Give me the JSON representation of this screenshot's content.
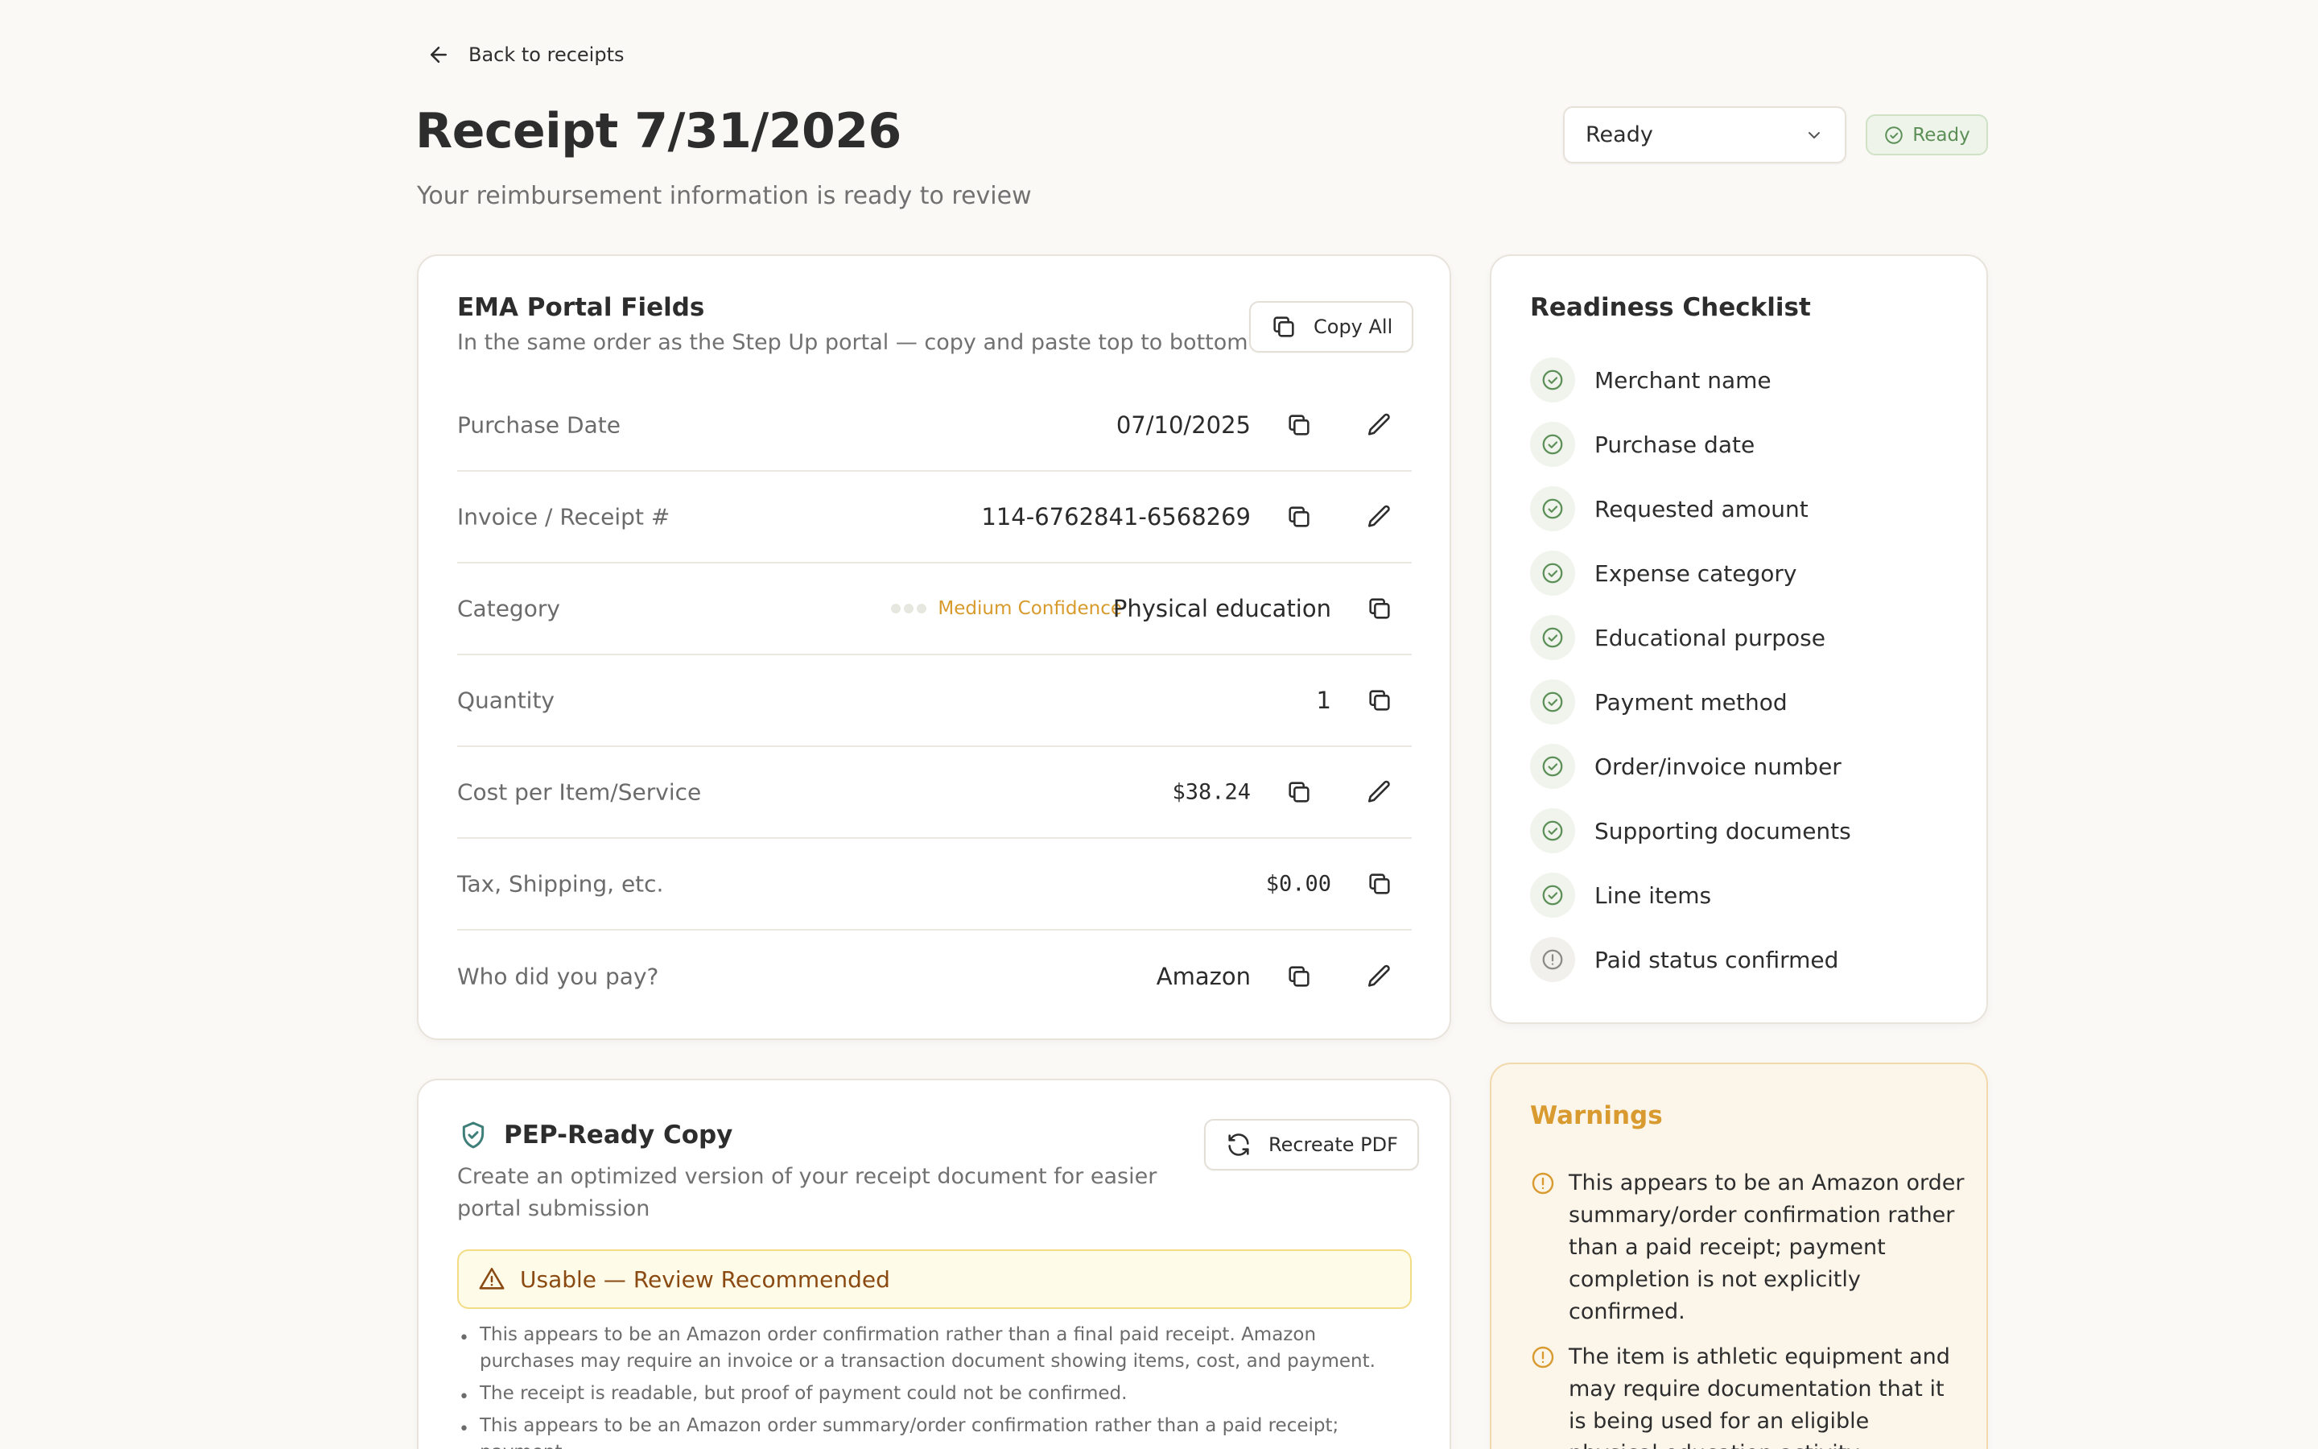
{
  "header": {
    "back_label": "Back to receipts",
    "title": "Receipt 7/31/2026",
    "subtitle": "Your reimbursement information is ready to review",
    "status_select_value": "Ready",
    "status_badge": "Ready"
  },
  "colors": {
    "accent_green": "#5c8f58",
    "warning_amber": "#d99a30",
    "background": "#faf9f6"
  },
  "fields_card": {
    "title": "EMA Portal Fields",
    "subtitle": "In the same order as the Step Up portal — copy and paste top to bottom",
    "copy_all_label": "Copy All",
    "rows": [
      {
        "label": "Purchase Date",
        "value": "07/10/2025",
        "editable": true
      },
      {
        "label": "Invoice / Receipt #",
        "value": "114-6762841-6568269",
        "editable": true
      },
      {
        "label": "Category",
        "value": "Physical education",
        "confidence": "Medium Confidence",
        "editable": false
      },
      {
        "label": "Quantity",
        "value": "1",
        "editable": false
      },
      {
        "label": "Cost per Item/Service",
        "value": "$38.24",
        "editable": true
      },
      {
        "label": "Tax, Shipping, etc.",
        "value": "$0.00",
        "editable": false
      },
      {
        "label": "Who did you pay?",
        "value": "Amazon",
        "editable": true
      }
    ]
  },
  "checklist": {
    "title": "Readiness Checklist",
    "items": [
      {
        "label": "Merchant name",
        "status": "complete"
      },
      {
        "label": "Purchase date",
        "status": "complete"
      },
      {
        "label": "Requested amount",
        "status": "complete"
      },
      {
        "label": "Expense category",
        "status": "complete"
      },
      {
        "label": "Educational purpose",
        "status": "complete"
      },
      {
        "label": "Payment method",
        "status": "complete"
      },
      {
        "label": "Order/invoice number",
        "status": "complete"
      },
      {
        "label": "Supporting documents",
        "status": "complete"
      },
      {
        "label": "Line items",
        "status": "complete"
      },
      {
        "label": "Paid status confirmed",
        "status": "pending"
      }
    ]
  },
  "pep": {
    "title": "PEP-Ready Copy",
    "subtitle": "Create an optimized version of your receipt document for easier portal submission",
    "recreate_label": "Recreate PDF",
    "banner": "Usable — Review Recommended",
    "notes": [
      "This appears to be an Amazon order confirmation rather than a final paid receipt. Amazon purchases may require an invoice or a transaction document showing items, cost, and payment.",
      "The receipt is readable, but proof of payment could not be confirmed.",
      "This appears to be an Amazon order summary/order confirmation rather than a paid receipt; payment"
    ]
  },
  "warnings": {
    "title": "Warnings",
    "items": [
      "This appears to be an Amazon order summary/order confirmation rather than a paid receipt; payment completion is not explicitly confirmed.",
      "The item is athletic equipment and may require documentation that it is being used for an eligible physical education activity."
    ]
  }
}
